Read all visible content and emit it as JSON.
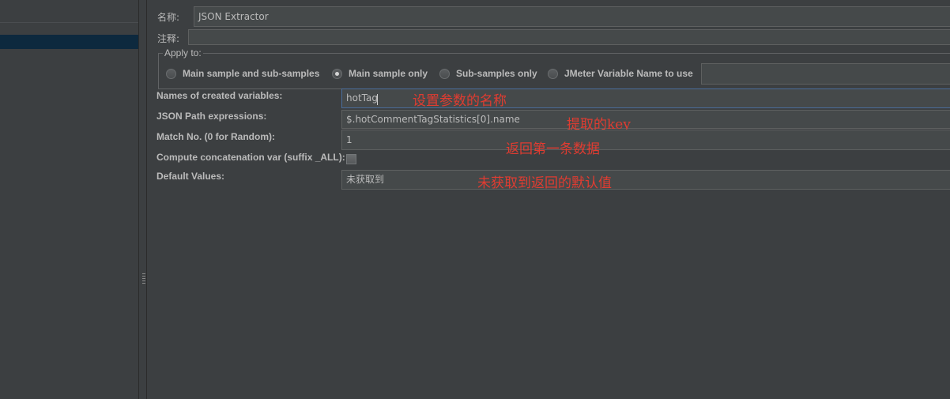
{
  "name_label": "名称:",
  "name_value": "JSON Extractor",
  "comment_label": "注释:",
  "comment_value": "",
  "apply_to": {
    "legend": "Apply to:",
    "options": [
      {
        "label": "Main sample and sub-samples",
        "checked": false
      },
      {
        "label": "Main sample only",
        "checked": true
      },
      {
        "label": "Sub-samples only",
        "checked": false
      },
      {
        "label": "JMeter Variable Name to use",
        "checked": false
      }
    ],
    "variable_name_value": ""
  },
  "fields": {
    "variable_names": {
      "label": "Names of created variables:",
      "value": "hotTag"
    },
    "json_path": {
      "label": "JSON Path expressions:",
      "value": "$.hotCommentTagStatistics[0].name"
    },
    "match_no": {
      "label": "Match No. (0 for Random):",
      "value": "1"
    },
    "concatenation": {
      "label": "Compute concatenation var (suffix _ALL):",
      "checked": false
    },
    "default_values": {
      "label": "Default Values:",
      "value": "未获取到"
    }
  },
  "annotations": {
    "variable_names": "设置参数的名称",
    "json_path": "提取的key",
    "match_no": "返回第一条数据",
    "default_values": "未获取到返回的默认值"
  },
  "colors": {
    "background": "#3c3f41",
    "field_background": "#45494a",
    "annotation_red": "#e03c31",
    "tree_selection": "#0d293e",
    "focus_border": "#4a6d9b"
  }
}
